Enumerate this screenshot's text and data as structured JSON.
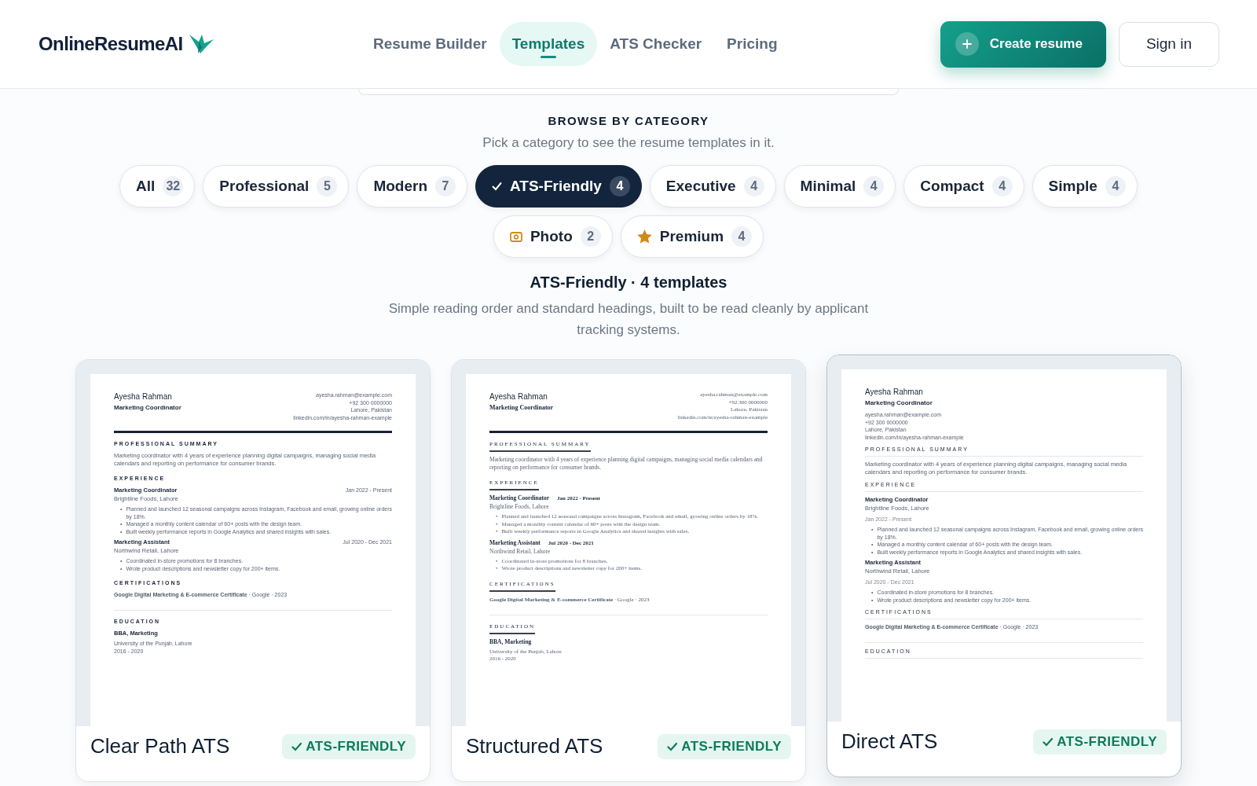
{
  "brand": {
    "name": "OnlineResumeAI"
  },
  "nav": [
    {
      "label": "Resume Builder",
      "selected": false
    },
    {
      "label": "Templates",
      "selected": true
    },
    {
      "label": "ATS Checker",
      "selected": false
    },
    {
      "label": "Pricing",
      "selected": false
    }
  ],
  "actions": {
    "create": "Create resume",
    "sign_in": "Sign in"
  },
  "browse": {
    "heading": "BROWSE BY CATEGORY",
    "subtitle": "Pick a category to see the resume templates in it."
  },
  "categories": [
    {
      "label": "All",
      "count": "32",
      "selected": false,
      "kind": "plain"
    },
    {
      "label": "Professional",
      "count": "5",
      "selected": false,
      "kind": "plain"
    },
    {
      "label": "Modern",
      "count": "7",
      "selected": false,
      "kind": "plain"
    },
    {
      "label": "ATS-Friendly",
      "count": "4",
      "selected": true,
      "kind": "plain"
    },
    {
      "label": "Executive",
      "count": "4",
      "selected": false,
      "kind": "plain"
    },
    {
      "label": "Minimal",
      "count": "4",
      "selected": false,
      "kind": "plain"
    },
    {
      "label": "Compact",
      "count": "4",
      "selected": false,
      "kind": "plain"
    },
    {
      "label": "Simple",
      "count": "4",
      "selected": false,
      "kind": "plain"
    },
    {
      "label": "Photo",
      "count": "2",
      "selected": false,
      "kind": "photo"
    },
    {
      "label": "Premium",
      "count": "4",
      "selected": false,
      "kind": "premium"
    }
  ],
  "results": {
    "title": "ATS-Friendly · 4 templates",
    "description": "Simple reading order and standard headings, built to be read cleanly by applicant tracking systems."
  },
  "templates": [
    {
      "title": "Clear Path ATS",
      "badge": "ATS-FRIENDLY",
      "hovered": false,
      "kind": "classic",
      "resume": {
        "bullet_marker": "•",
        "name": "Ayesha Rahman",
        "role": "Marketing Coordinator",
        "contacts": [
          "ayesha.rahman@example.com",
          "+92 300 0000000",
          "Lahore, Pakistan",
          "linkedin.com/in/ayesha-rahman-example"
        ],
        "summary_heading": "PROFESSIONAL SUMMARY",
        "summary": "Marketing coordinator with 4 years of experience planning digital campaigns, managing social media calendars and reporting on performance for consumer brands.",
        "experience_heading": "EXPERIENCE",
        "jobs": [
          {
            "title": "Marketing Coordinator",
            "dates": "Jan 2022 - Present",
            "company": "Brightline Foods, Lahore",
            "bullets": [
              "Planned and launched 12 seasonal campaigns across Instagram, Facebook and email, growing online orders by 18%.",
              "Managed a monthly content calendar of 60+ posts with the design team.",
              "Built weekly performance reports in Google Analytics and shared insights with sales."
            ]
          },
          {
            "title": "Marketing Assistant",
            "dates": "Jul 2020 - Dec 2021",
            "company": "Northwind Retail, Lahore",
            "bullets": [
              "Coordinated in-store promotions for 8 branches.",
              "Wrote product descriptions and newsletter copy for 200+ items."
            ]
          }
        ],
        "certifications_heading": "CERTIFICATIONS",
        "certifications": [
          "**Google Digital Marketing & E-commerce Certificate** · Google · 2023"
        ],
        "education_heading": "EDUCATION",
        "education": [
          {
            "degree": "BBA, Marketing",
            "school": "University of the Punjab, Lahore",
            "years": "2016 - 2020"
          }
        ]
      }
    },
    {
      "title": "Structured ATS",
      "badge": "ATS-FRIENDLY",
      "hovered": false,
      "kind": "serif",
      "resume": {
        "bullet_marker": "•",
        "name": "Ayesha Rahman",
        "role": "Marketing Coordinator",
        "contacts": [
          "ayesha.rahman@example.com",
          "+92 300 0000000",
          "Lahore, Pakistan",
          "linkedin.com/in/ayesha-rahman-example"
        ],
        "summary_heading": "PROFESSIONAL SUMMARY",
        "summary": "Marketing coordinator with 4 years of experience planning digital campaigns, managing social media calendars and reporting on performance for consumer brands.",
        "experience_heading": "EXPERIENCE",
        "jobs": [
          {
            "title": "Marketing Coordinator",
            "dates": "Jan 2022 - Present",
            "company": "Brightline Foods, Lahore",
            "bullets": [
              "Planned and launched 12 seasonal campaigns across Instagram, Facebook and email, growing online orders by 18%.",
              "Managed a monthly content calendar of 60+ posts with the design team.",
              "Built weekly performance reports in Google Analytics and shared insights with sales."
            ]
          },
          {
            "title": "Marketing Assistant",
            "dates": "Jul 2020 - Dec 2021",
            "company": "Northwind Retail, Lahore",
            "bullets": [
              "Coordinated in-store promotions for 8 branches.",
              "Wrote product descriptions and newsletter copy for 200+ items."
            ]
          }
        ],
        "certifications_heading": "CERTIFICATIONS",
        "certifications": [
          "**Google Digital Marketing & E-commerce Certificate** · Google · 2023"
        ],
        "education_heading": "EDUCATION",
        "education": [
          {
            "degree": "BBA, Marketing",
            "school": "University of the Punjab, Lahore",
            "years": "2016 - 2020"
          }
        ]
      }
    },
    {
      "title": "Direct ATS",
      "badge": "ATS-FRIENDLY",
      "hovered": true,
      "kind": "stacked",
      "resume": {
        "bullet_marker": "•",
        "name": "Ayesha Rahman",
        "role": "Marketing Coordinator",
        "contacts": [
          "ayesha.rahman@example.com",
          "+92 300 0000000",
          "Lahore, Pakistan",
          "linkedin.com/in/ayesha-rahman-example"
        ],
        "summary_heading": "PROFESSIONAL SUMMARY",
        "summary": "Marketing coordinator with 4 years of experience planning digital campaigns, managing social media calendars and reporting on performance for consumer brands.",
        "experience_heading": "EXPERIENCE",
        "jobs": [
          {
            "title": "Marketing Coordinator",
            "dates": "Jan 2022 - Present",
            "company": "Brightline Foods, Lahore",
            "bullets": [
              "Planned and launched 12 seasonal campaigns across Instagram, Facebook and email, growing online orders by 18%.",
              "Managed a monthly content calendar of 60+ posts with the design team.",
              "Built weekly performance reports in Google Analytics and shared insights with sales."
            ]
          },
          {
            "title": "Marketing Assistant",
            "dates": "Jul 2020 - Dec 2021",
            "company": "Northwind Retail, Lahore",
            "bullets": [
              "Coordinated in-store promotions for 8 branches.",
              "Wrote product descriptions and newsletter copy for 200+ items."
            ]
          }
        ],
        "certifications_heading": "CERTIFICATIONS",
        "certifications": [
          "**Google Digital Marketing & E-commerce Certificate** · Google · 2023"
        ],
        "education_heading": "EDUCATION"
      }
    }
  ]
}
